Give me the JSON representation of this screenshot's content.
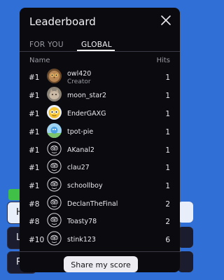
{
  "background": {
    "button_1_letter": "H",
    "button_2_letter": "L",
    "button_3_letter": "R"
  },
  "modal": {
    "title": "Leaderboard",
    "tabs": [
      {
        "label": "FOR YOU",
        "active": false
      },
      {
        "label": "GLOBAL",
        "active": true
      }
    ],
    "columns": {
      "name": "Name",
      "hits": "Hits"
    },
    "rows": [
      {
        "rank": "#1",
        "name": "owl420",
        "subtitle": "Creator",
        "hits": "1",
        "avatar": "owl-photo"
      },
      {
        "rank": "#1",
        "name": "moon_star2",
        "hits": "1",
        "avatar": "cat-photo"
      },
      {
        "rank": "#1",
        "name": "EnderGAXG",
        "hits": "1",
        "avatar": "emoji-face"
      },
      {
        "rank": "#1",
        "name": "tpot-pie",
        "hits": "1",
        "avatar": "blue-character"
      },
      {
        "rank": "#1",
        "name": "AKanal2",
        "hits": "1",
        "avatar": "default-owl-avatar"
      },
      {
        "rank": "#1",
        "name": "clau27",
        "hits": "1",
        "avatar": "default-owl-avatar"
      },
      {
        "rank": "#1",
        "name": "schoollboy",
        "hits": "1",
        "avatar": "default-owl-avatar"
      },
      {
        "rank": "#8",
        "name": "DeclanTheFinal",
        "hits": "2",
        "avatar": "default-owl-avatar"
      },
      {
        "rank": "#8",
        "name": "Toasty78",
        "hits": "2",
        "avatar": "default-owl-avatar"
      },
      {
        "rank": "#10",
        "name": "stink123",
        "hits": "6",
        "avatar": "default-owl-avatar"
      }
    ],
    "share_button": "Share my score"
  },
  "colors": {
    "background": "#2f6fd6",
    "modal": "#0b0b0f",
    "accent_green": "#40c046"
  }
}
